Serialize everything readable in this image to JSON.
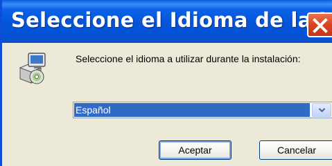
{
  "window": {
    "title": "Seleccione el Idioma de la In...",
    "close_icon": "close-x-icon",
    "app_icon": "installer-icon"
  },
  "dialog": {
    "prompt": "Seleccione el idioma a utilizar durante la instalación:",
    "language_select": {
      "selected": "Español"
    },
    "ok_label": "Aceptar",
    "cancel_label": "Cancelar"
  },
  "colors": {
    "titlebar": "#0554d8",
    "selection": "#316ac5",
    "close_button": "#d9431e",
    "dialog_background": "#ece9d8"
  }
}
